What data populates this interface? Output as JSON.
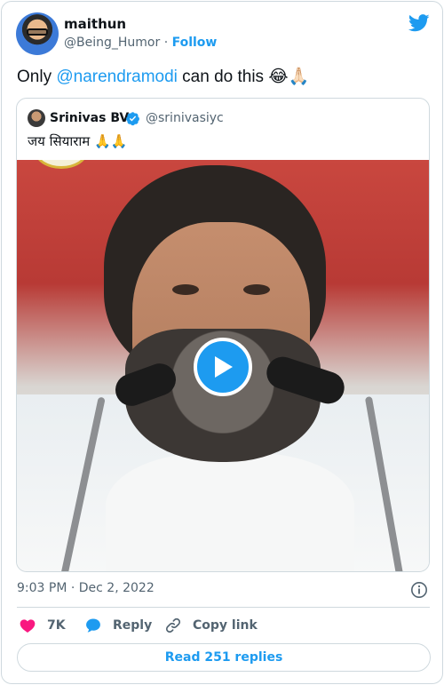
{
  "author": {
    "name": "maithun",
    "handle": "@Being_Humor",
    "separator": "·",
    "follow_label": "Follow"
  },
  "tweet": {
    "text_before": "Only ",
    "mention": "@narendramodi",
    "text_after": " can do this 😂🙏🏻"
  },
  "quoted_tweet": {
    "name": "Srinivas BV",
    "handle": "@srinivasiyc",
    "text": "जय सियाराम 🙏🙏",
    "media": {
      "type": "video",
      "play_icon": "play-icon"
    }
  },
  "meta": {
    "timestamp": "9:03 PM · Dec 2, 2022",
    "info_icon": "info-icon"
  },
  "actions": {
    "like_count": "7K",
    "reply_label": "Reply",
    "copy_label": "Copy link"
  },
  "read_replies_label": "Read 251 replies",
  "colors": {
    "accent": "#1d9bf0",
    "like": "#f91880",
    "text_secondary": "#536471",
    "border": "#cfd9de"
  }
}
